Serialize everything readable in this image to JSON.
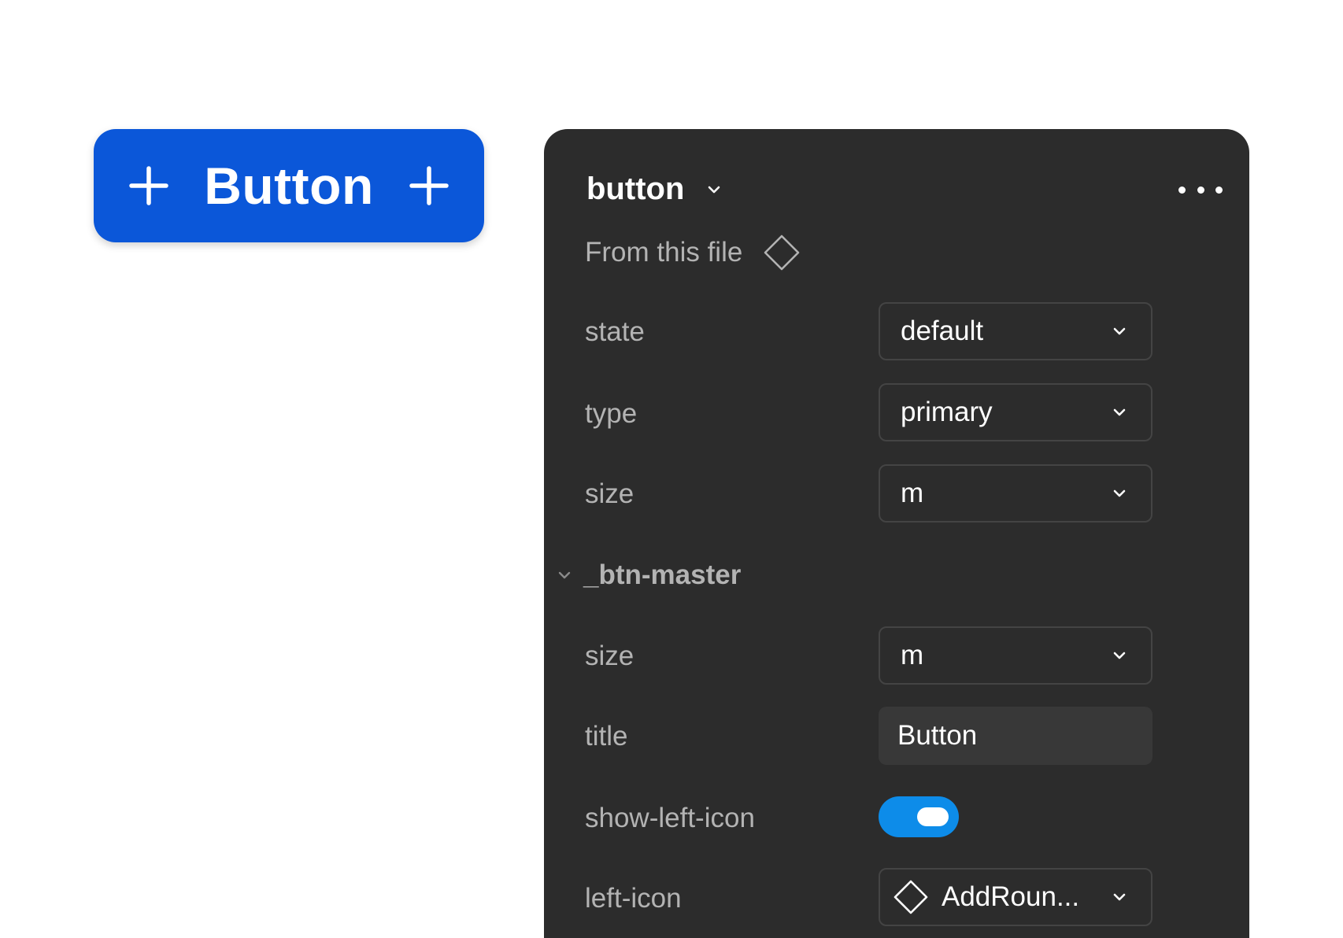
{
  "preview_button": {
    "label": "Button",
    "left_icon": "plus-icon",
    "right_icon": "plus-icon",
    "color": "#0b57d9"
  },
  "panel": {
    "title": "button",
    "source": "From this file",
    "more_icon": "more-horizontal-icon",
    "properties": [
      {
        "label": "state",
        "value": "default"
      },
      {
        "label": "type",
        "value": "primary"
      },
      {
        "label": "size",
        "value": "m"
      }
    ],
    "section": {
      "title": "_btn-master",
      "expanded": true,
      "size": {
        "label": "size",
        "value": "m"
      },
      "title_prop": {
        "label": "title",
        "value": "Button"
      },
      "show_left_icon": {
        "label": "show-left-icon",
        "on": true,
        "color": "#0d8ce9"
      },
      "left_icon": {
        "label": "left-icon",
        "value": "AddRoun..."
      }
    }
  }
}
